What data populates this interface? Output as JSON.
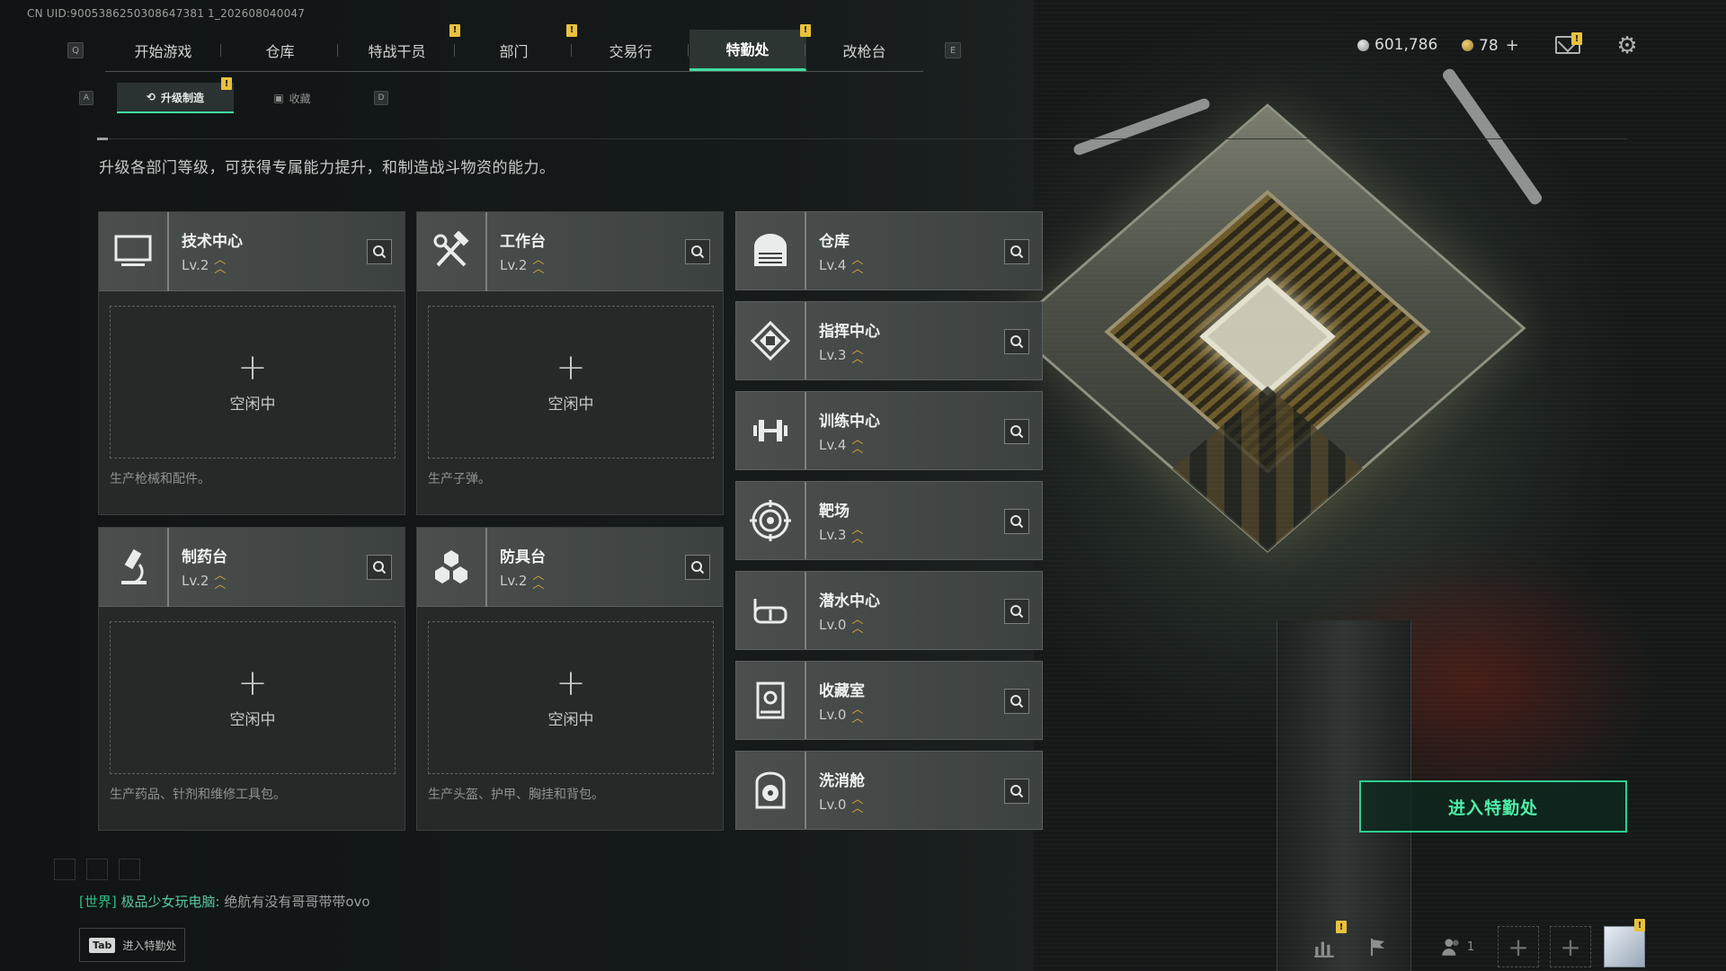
{
  "uid": "CN UID:9005386250308647381 1_202608040047",
  "nav": {
    "left_key": "Q",
    "right_key": "E",
    "tabs": [
      {
        "label": "开始游戏"
      },
      {
        "label": "仓库"
      },
      {
        "label": "特战干员",
        "badge": "!"
      },
      {
        "label": "部门",
        "badge": "!"
      },
      {
        "label": "交易行"
      },
      {
        "label": "特勤处",
        "badge": "!",
        "active": true
      },
      {
        "label": "改枪台"
      }
    ]
  },
  "currency": {
    "coins": "601,786",
    "tickets": "78"
  },
  "mail_badge": "!",
  "subnav": {
    "left_key": "A",
    "right_key": "D",
    "tabs": [
      {
        "label": "升级制造",
        "badge": "!",
        "active": true
      },
      {
        "label": "收藏"
      }
    ]
  },
  "description": "升级各部门等级，可获得专属能力提升，和制造战斗物资的能力。",
  "production_cards": [
    {
      "name": "技术中心",
      "level": "Lv.2",
      "icon": "monitor-icon",
      "slot_text": "空闲中",
      "footer": "生产枪械和配件。"
    },
    {
      "name": "工作台",
      "level": "Lv.2",
      "icon": "tools-icon",
      "slot_text": "空闲中",
      "footer": "生产子弹。"
    },
    {
      "name": "制药台",
      "level": "Lv.2",
      "icon": "microscope-icon",
      "slot_text": "空闲中",
      "footer": "生产药品、针剂和维修工具包。"
    },
    {
      "name": "防具台",
      "level": "Lv.2",
      "icon": "hexagons-icon",
      "slot_text": "空闲中",
      "footer": "生产头盔、护甲、胸挂和背包。"
    }
  ],
  "departments": [
    {
      "name": "仓库",
      "level": "Lv.4",
      "icon": "warehouse-icon"
    },
    {
      "name": "指挥中心",
      "level": "Lv.3",
      "icon": "command-chip-icon"
    },
    {
      "name": "训练中心",
      "level": "Lv.4",
      "icon": "dumbbell-icon"
    },
    {
      "name": "靶场",
      "level": "Lv.3",
      "icon": "target-icon"
    },
    {
      "name": "潜水中心",
      "level": "Lv.0",
      "icon": "diving-mask-icon"
    },
    {
      "name": "收藏室",
      "level": "Lv.0",
      "icon": "collection-cabinet-icon"
    },
    {
      "name": "洗消舱",
      "level": "Lv.0",
      "icon": "radiation-icon"
    }
  ],
  "enter_button": "进入特勤处",
  "chat": {
    "channel": "[世界]",
    "sender": "极品少女玩电脑:",
    "message": "绝航有没有哥哥带带ovo"
  },
  "tab_hint": {
    "key": "Tab",
    "label": "进入特勤处"
  },
  "bottom": {
    "squad_count": "1",
    "stats_badge": "!",
    "avatar_badge": "!"
  },
  "colors": {
    "accent": "#3fe0a0",
    "badge": "#e9c13d",
    "level_chevron": "#e0a83a"
  }
}
